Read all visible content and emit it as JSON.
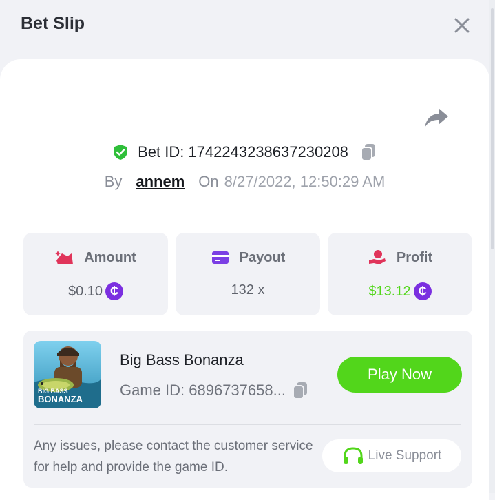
{
  "header": {
    "title": "Bet Slip",
    "close_icon": "close-icon"
  },
  "bet": {
    "id_label": "Bet ID: 1742243238637230208",
    "by_label": "By",
    "user": "annem",
    "on_label": "On",
    "date": "8/27/2022, 12:50:29 AM"
  },
  "stats": {
    "amount": {
      "label": "Amount",
      "value": "$0.10",
      "coin": "₵"
    },
    "payout": {
      "label": "Payout",
      "value": "132 x"
    },
    "profit": {
      "label": "Profit",
      "value": "$13.12",
      "coin": "₵"
    }
  },
  "game": {
    "name": "Big Bass Bonanza",
    "id_label": "Game ID: 6896737658...",
    "thumb_text_top": "BIG BASS",
    "thumb_text_bottom": "BONANZA",
    "play_label": "Play Now"
  },
  "support": {
    "help_text": "Any issues, please contact the customer service for help and provide the game ID.",
    "button_label": "Live Support"
  },
  "colors": {
    "accent_green": "#52d61b",
    "profit_green": "#52d61b",
    "coin_purple": "#7b2fe0",
    "amount_icon": "#e0345a",
    "payout_icon": "#7b3fe4",
    "profit_icon": "#e0345a"
  }
}
